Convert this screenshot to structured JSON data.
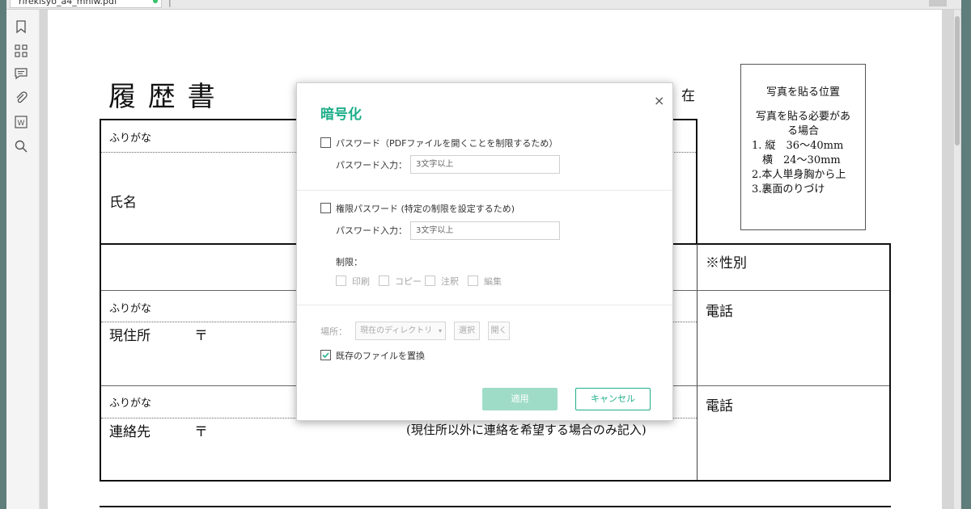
{
  "tab": {
    "title": "rirekisyo_a4_mhlw.pdf"
  },
  "sidebar": {
    "icons": [
      "bookmark-icon",
      "thumbnails-icon",
      "comment-icon",
      "attachment-icon",
      "word-icon",
      "search-icon"
    ]
  },
  "document": {
    "title": "履 歴 書",
    "date_suffix": "在",
    "furigana": "ふりがな",
    "name_label": "氏名",
    "gender_label": "※性別",
    "address_label": "現住所",
    "postal_mark": "〒",
    "phone_label": "電話",
    "contact_label": "連絡先",
    "contact_note": "(現住所以外に連絡を希望する場合のみ記入)",
    "photo_box": {
      "title": "写真を貼る位置",
      "line1": "写真を貼る必要があ",
      "line2": "る場合",
      "line3": "1. 縦　36〜40mm",
      "line4": "　横　24〜30mm",
      "line5": "2.本人単身胸から上",
      "line6": "3.裏面のりづけ"
    }
  },
  "dialog": {
    "title": "暗号化",
    "open_password": {
      "label": "パスワード（PDFファイルを開くことを制限するため）",
      "input_label": "パスワード入力：",
      "placeholder": "3文字以上",
      "checked": false
    },
    "permission_password": {
      "label": "権限パスワード (特定の制限を設定するため)",
      "input_label": "パスワード入力：",
      "placeholder": "3文字以上",
      "checked": false
    },
    "restrictions": {
      "label": "制限：",
      "print": "印刷",
      "copy": "コピー",
      "annotate": "注釈",
      "edit": "編集"
    },
    "location": {
      "label": "場所：",
      "value": "現在のディレクトリ",
      "select_button": "選択",
      "open_button": "開く"
    },
    "overwrite": {
      "label": "既存のファイルを置換",
      "checked": true
    },
    "apply_button": "適用",
    "cancel_button": "キャンセル"
  }
}
